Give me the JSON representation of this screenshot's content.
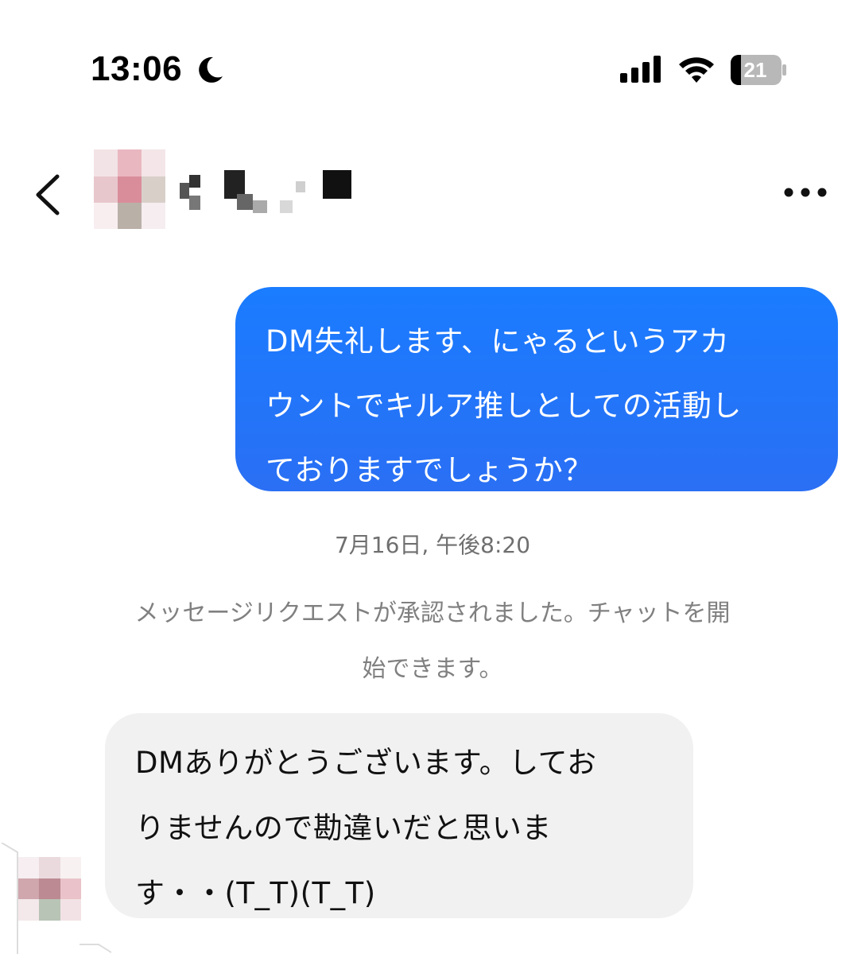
{
  "status_bar": {
    "time": "13:06",
    "battery_level": "21",
    "icons": [
      "moon-icon",
      "signal-icon",
      "wifi-icon",
      "battery-icon"
    ]
  },
  "header": {
    "icons": [
      "chevron-left-icon",
      "more-horizontal-icon"
    ]
  },
  "messages": {
    "outgoing_text": "DM失礼します、にゃるというアカ\nウントでキルア推しとしての活動し\nておりますでしょうか？",
    "timestamp": "7月16日, 午後8:20",
    "system_notice": "メッセージリクエストが承認されました。チャットを開\n始できます。",
    "incoming_text": "DMありがとうございます。してお\nりませんので勘違いだと思いま\nす・・(T_T)(T_T)"
  },
  "colors": {
    "outgoing_bubble": "#1f77ff",
    "incoming_bubble": "#f1f1f2",
    "meta_text": "#6f6f6f"
  }
}
